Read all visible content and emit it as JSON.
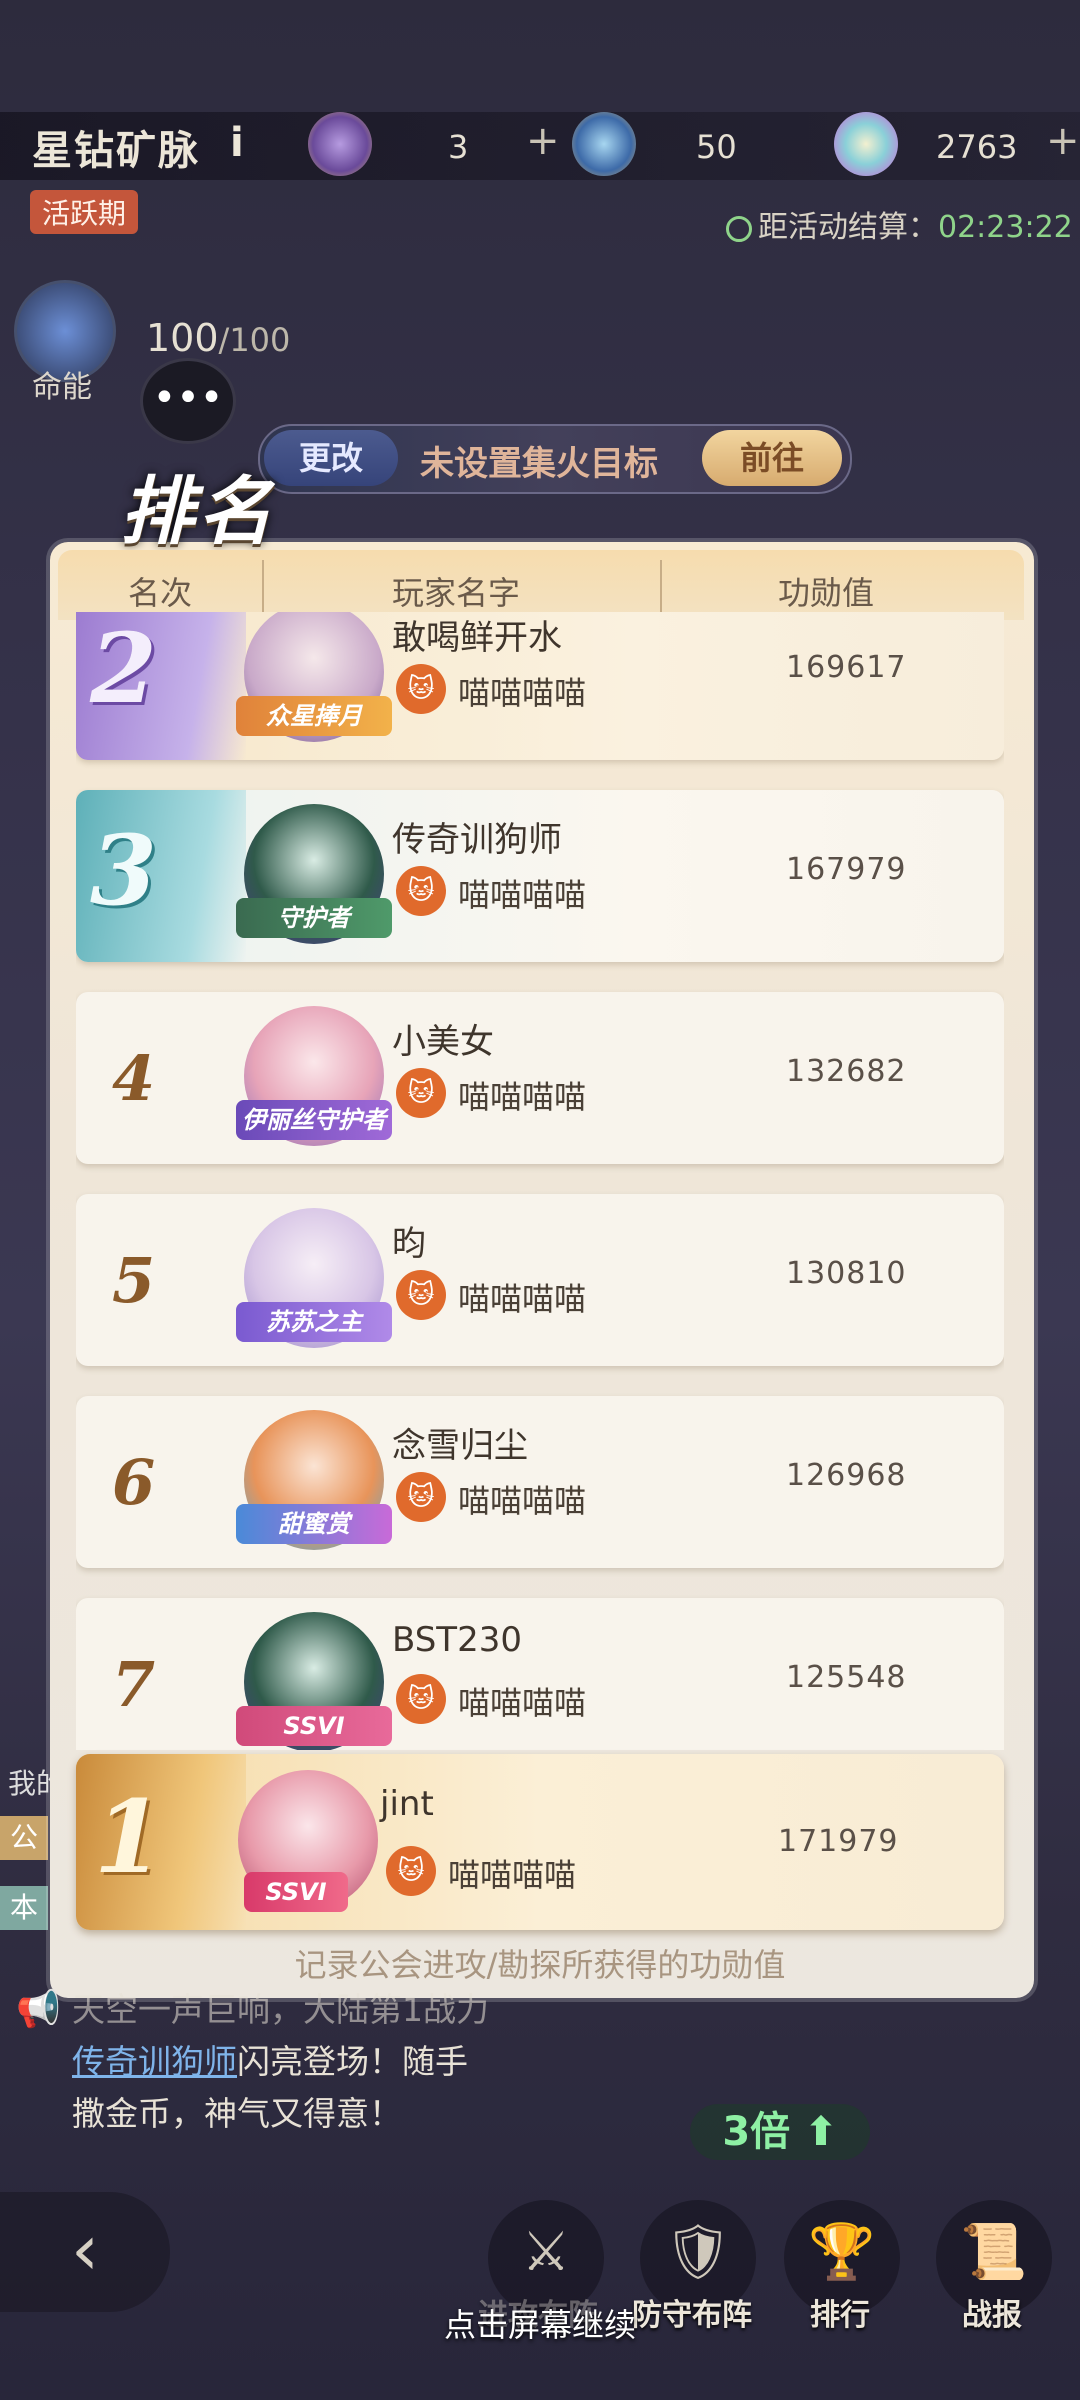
{
  "header": {
    "title": "星钻矿脉",
    "info_icon": "i",
    "resources": [
      {
        "icon": "purple-ore-icon",
        "value": "3"
      },
      {
        "icon": "planet-gem-icon",
        "value": "50"
      },
      {
        "icon": "rainbow-gem-icon",
        "value": "2763"
      }
    ],
    "plus": "+",
    "phase_badge": "活跃期",
    "timer_label": "距活动结算：",
    "timer_value": "02:23:22"
  },
  "energy": {
    "label": "命能",
    "current": "100",
    "max": "/100"
  },
  "goal": {
    "change_label": "更改",
    "text": "未设置集火目标",
    "go_label": "前往"
  },
  "ranking": {
    "title": "排名",
    "col_rank": "名次",
    "col_name": "玩家名字",
    "col_score": "功勋值",
    "rows": [
      {
        "rank": "2",
        "name": "敢喝鲜开水",
        "guild": "喵喵喵喵",
        "score": "169617",
        "tag": "众星捧月"
      },
      {
        "rank": "3",
        "name": "传奇训狗师",
        "guild": "喵喵喵喵",
        "score": "167979",
        "tag": "守护者"
      },
      {
        "rank": "4",
        "name": "小美女",
        "guild": "喵喵喵喵",
        "score": "132682",
        "tag": "伊丽丝守护者"
      },
      {
        "rank": "5",
        "name": "昀",
        "guild": "喵喵喵喵",
        "score": "130810",
        "tag": "苏苏之主"
      },
      {
        "rank": "6",
        "name": "念雪归尘",
        "guild": "喵喵喵喵",
        "score": "126968",
        "tag": "甜蜜赏"
      },
      {
        "rank": "7",
        "name": "BST230",
        "guild": "喵喵喵喵",
        "score": "125548",
        "tag": "SSVI"
      }
    ],
    "self": {
      "rank": "1",
      "name": "jint",
      "guild": "喵喵喵喵",
      "score": "171979",
      "tag": "SSVI"
    },
    "footnote": "记录公会进攻/勘探所获得的功勋值"
  },
  "broadcast": {
    "line1": "天空一声巨响，大陆第1战力",
    "highlight": "传奇训狗师",
    "line2_rest": "闪亮登场！随手",
    "line3": "撒金币，神气又得意！"
  },
  "multiplier": "3倍",
  "side_peek": [
    "我的",
    "公",
    "本"
  ],
  "nav": {
    "back": "‹",
    "items": [
      {
        "icon": "swords-icon",
        "label": "进攻布阵"
      },
      {
        "icon": "shield-icon",
        "label": "防守布阵"
      },
      {
        "icon": "trophy-icon",
        "label": "排行"
      },
      {
        "icon": "report-icon",
        "label": "战报"
      }
    ]
  },
  "continue_hint": "点击屏幕继续",
  "colors": {
    "accent_gold": "#d7ab6f",
    "timer_green": "#8fd48a",
    "guild_orange": "#e06a2c"
  }
}
